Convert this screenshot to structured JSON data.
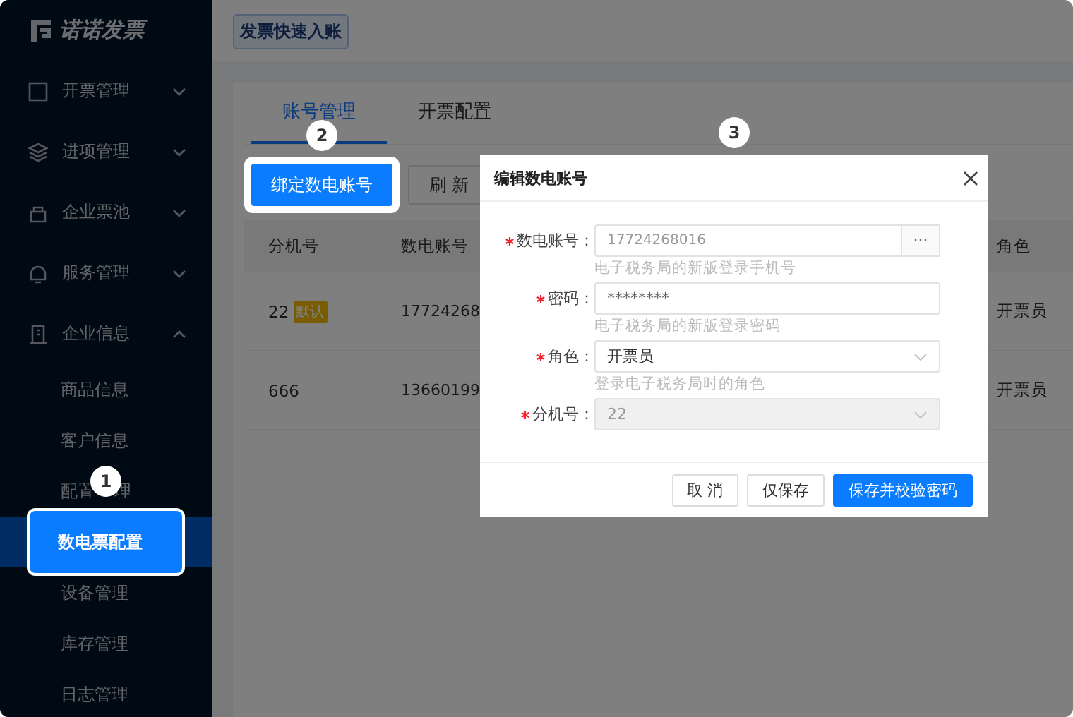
{
  "logo": {
    "text": "诺诺发票"
  },
  "top_bar": {
    "button": "发票快速入账"
  },
  "sidebar": {
    "items": [
      {
        "label": "开票管理",
        "expanded": false
      },
      {
        "label": "进项管理",
        "expanded": false
      },
      {
        "label": "企业票池",
        "expanded": false
      },
      {
        "label": "服务管理",
        "expanded": false
      },
      {
        "label": "企业信息",
        "expanded": true,
        "children": [
          {
            "label": "商品信息",
            "selected": false
          },
          {
            "label": "客户信息",
            "selected": false
          },
          {
            "label": "配置",
            "label_tail": "理",
            "selected": false
          },
          {
            "label": "数电票配置",
            "selected": true
          },
          {
            "label": "设备管理",
            "selected": false
          },
          {
            "label": "库存管理",
            "selected": false
          },
          {
            "label": "日志管理",
            "selected": false
          }
        ]
      }
    ]
  },
  "tabs": [
    {
      "label": "账号管理",
      "selected": true
    },
    {
      "label": "开票配置",
      "selected": false
    }
  ],
  "toolbar": {
    "primary_button": "绑定数电账号",
    "refresh_button": "刷 新"
  },
  "table": {
    "columns": [
      "分机号",
      "数电账号",
      "角色"
    ],
    "rows": [
      {
        "extension": "22",
        "default_tag": "默认",
        "account": "17724268",
        "role": "开票员"
      },
      {
        "extension": "666",
        "account": "13660199",
        "role": "开票员"
      }
    ]
  },
  "dialog": {
    "title": "编辑数电账号",
    "fields": [
      {
        "kind": "text_with_button",
        "label": "数电账号：",
        "value": "17724268016",
        "button": "···",
        "hint": "电子税务局的新版登录手机号",
        "required": true,
        "disabled": false
      },
      {
        "kind": "password",
        "label": "密码：",
        "value": "********",
        "hint": "电子税务局的新版登录密码",
        "required": true,
        "disabled": false
      },
      {
        "kind": "select",
        "label": "角色：",
        "value": "开票员",
        "hint": "登录电子税务局时的角色",
        "required": true,
        "disabled": false
      },
      {
        "kind": "select",
        "label": "分机号：",
        "value": "22",
        "required": true,
        "disabled": true
      }
    ],
    "buttons": [
      {
        "label": "取 消",
        "kind": "default"
      },
      {
        "label": "仅保存",
        "kind": "default"
      },
      {
        "label": "保存并校验密码",
        "kind": "primary"
      }
    ]
  },
  "guide_badges": [
    "1",
    "2",
    "3"
  ]
}
